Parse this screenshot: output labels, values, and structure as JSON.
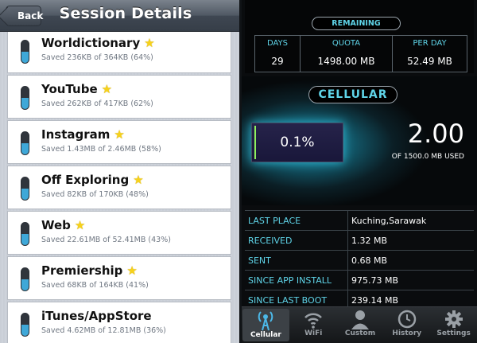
{
  "navbar": {
    "back_label": "Back",
    "title": "Session Details"
  },
  "apps": [
    {
      "name": "Worldictionary",
      "saved": "Saved 236KB of 364KB (64%)"
    },
    {
      "name": "YouTube",
      "saved": "Saved 262KB of 417KB (62%)"
    },
    {
      "name": "Instagram",
      "saved": "Saved 1.43MB of 2.46MB (58%)"
    },
    {
      "name": "Off Exploring",
      "saved": "Saved 82KB of 170KB (48%)"
    },
    {
      "name": "Web",
      "saved": "Saved 22.61MB of 52.41MB (43%)"
    },
    {
      "name": "Premiership",
      "saved": "Saved 68KB of 164KB (41%)"
    },
    {
      "name": "iTunes/AppStore",
      "saved": "Saved 4.62MB of 12.81MB (36%)"
    }
  ],
  "remaining": {
    "label": "REMAINING",
    "days_header": "DAYS",
    "days_value": "29",
    "quota_header": "QUOTA",
    "quota_value": "1498.00 MB",
    "perday_header": "PER DAY",
    "perday_value": "52.49 MB"
  },
  "cellular": {
    "label": "CELLULAR",
    "usage_percent": "0.1%",
    "used_value": "2.00",
    "used_of": "OF 1500.0 MB USED"
  },
  "info": [
    {
      "label": "LAST PLACE",
      "value": "Kuching,Sarawak"
    },
    {
      "label": "RECEIVED",
      "value": "1.32 MB"
    },
    {
      "label": "SENT",
      "value": "0.68 MB"
    },
    {
      "label": "SINCE APP INSTALL",
      "value": "975.73 MB"
    },
    {
      "label": "SINCE LAST BOOT",
      "value": "239.14 MB"
    }
  ],
  "tabs": [
    {
      "label": "Cellular",
      "icon": "cellular-tower-icon",
      "active": true
    },
    {
      "label": "WiFi",
      "icon": "wifi-icon",
      "active": false
    },
    {
      "label": "Custom",
      "icon": "person-icon",
      "active": false
    },
    {
      "label": "History",
      "icon": "clock-icon",
      "active": false
    },
    {
      "label": "Settings",
      "icon": "gear-icon",
      "active": false
    }
  ],
  "colors": {
    "accent": "#5fd4e8",
    "star": "#f7d21a",
    "usage_fill": "#8ef05e"
  }
}
